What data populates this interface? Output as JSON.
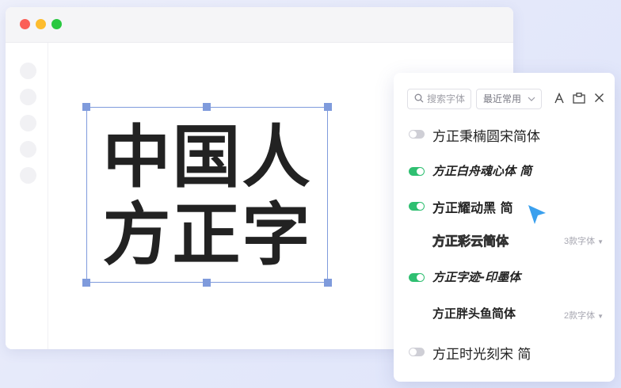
{
  "window": {
    "sidebar_dots": 5
  },
  "canvas": {
    "line1": "中国人",
    "line2": "方正字"
  },
  "panel": {
    "search_placeholder": "搜索字体",
    "filter_value": "最近常用",
    "fonts": [
      {
        "name": "方正秉楠圆宋简体",
        "toggle": "off",
        "count": ""
      },
      {
        "name": "方正白舟魂心体 简",
        "toggle": "on",
        "count": ""
      },
      {
        "name": "方正耀动黑 简",
        "toggle": "on",
        "count": ""
      },
      {
        "name": "方正彩云简体",
        "toggle": "none",
        "count": "3款字体"
      },
      {
        "name": "方正字迹-印墨体",
        "toggle": "on",
        "count": ""
      },
      {
        "name": "方正胖头鱼简体",
        "toggle": "none",
        "count": "2款字体"
      },
      {
        "name": "方正时光刻宋 简",
        "toggle": "off",
        "count": ""
      }
    ]
  },
  "colors": {
    "accent": "#7f9bdc",
    "toggle_on": "#2fbf71",
    "cursor": "#3aa0ee"
  }
}
